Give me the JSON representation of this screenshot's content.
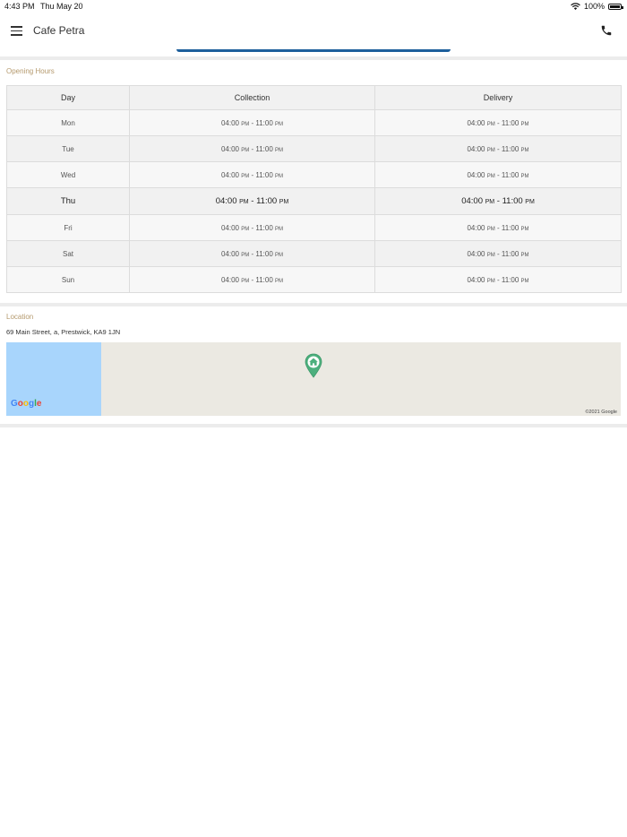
{
  "status_bar": {
    "time": "4:43 PM",
    "date": "Thu May 20",
    "battery": "100%"
  },
  "nav": {
    "title": "Cafe Petra",
    "menu_icon": "hamburger-menu-icon",
    "call_icon": "phone-icon"
  },
  "opening_hours": {
    "label": "Opening Hours",
    "headers": {
      "day": "Day",
      "collection": "Collection",
      "delivery": "Delivery"
    },
    "rows": [
      {
        "day": "Mon",
        "collection": {
          "open": "04:00",
          "open_ampm": "PM",
          "close": "11:00",
          "close_ampm": "PM"
        },
        "delivery": {
          "open": "04:00",
          "open_ampm": "PM",
          "close": "11:00",
          "close_ampm": "PM"
        }
      },
      {
        "day": "Tue",
        "collection": {
          "open": "04:00",
          "open_ampm": "PM",
          "close": "11:00",
          "close_ampm": "PM"
        },
        "delivery": {
          "open": "04:00",
          "open_ampm": "PM",
          "close": "11:00",
          "close_ampm": "PM"
        }
      },
      {
        "day": "Wed",
        "collection": {
          "open": "04:00",
          "open_ampm": "PM",
          "close": "11:00",
          "close_ampm": "PM"
        },
        "delivery": {
          "open": "04:00",
          "open_ampm": "PM",
          "close": "11:00",
          "close_ampm": "PM"
        }
      },
      {
        "day": "Thu",
        "collection": {
          "open": "04:00",
          "open_ampm": "PM",
          "close": "11:00",
          "close_ampm": "PM"
        },
        "delivery": {
          "open": "04:00",
          "open_ampm": "PM",
          "close": "11:00",
          "close_ampm": "PM"
        }
      },
      {
        "day": "Fri",
        "collection": {
          "open": "04:00",
          "open_ampm": "PM",
          "close": "11:00",
          "close_ampm": "PM"
        },
        "delivery": {
          "open": "04:00",
          "open_ampm": "PM",
          "close": "11:00",
          "close_ampm": "PM"
        }
      },
      {
        "day": "Sat",
        "collection": {
          "open": "04:00",
          "open_ampm": "PM",
          "close": "11:00",
          "close_ampm": "PM"
        },
        "delivery": {
          "open": "04:00",
          "open_ampm": "PM",
          "close": "11:00",
          "close_ampm": "PM"
        }
      },
      {
        "day": "Sun",
        "collection": {
          "open": "04:00",
          "open_ampm": "PM",
          "close": "11:00",
          "close_ampm": "PM"
        },
        "delivery": {
          "open": "04:00",
          "open_ampm": "PM",
          "close": "11:00",
          "close_ampm": "PM"
        }
      }
    ]
  },
  "location": {
    "label": "Location",
    "address": "69 Main Street, a, Prestwick, KA9 1JN",
    "map": {
      "logo": {
        "g1": "G",
        "o1": "o",
        "o2": "o",
        "g2": "g",
        "l": "l",
        "e": "e"
      },
      "copyright": "©2021 Google",
      "pin_icon": "home-map-pin-icon"
    }
  },
  "colors": {
    "accent_label": "#b59a6e",
    "nav_indicator": "#1d5f9c",
    "pin": "#4caf7d",
    "water": "#a8d5fc"
  }
}
